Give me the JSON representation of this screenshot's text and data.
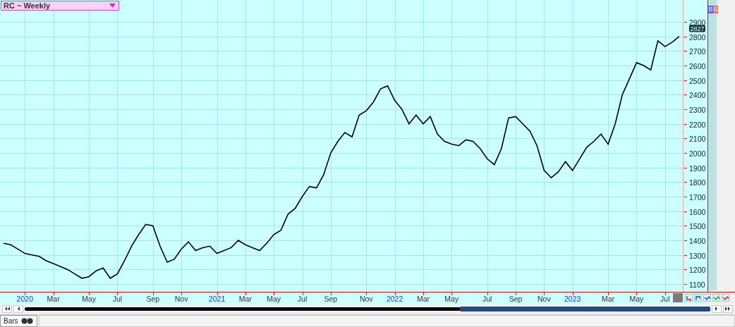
{
  "title_dropdown": {
    "label": "RC ~ Weekly"
  },
  "trade_buttons": [
    {
      "label": "B",
      "color": "#5a63f0"
    },
    {
      "label": "S",
      "color": "#f06a6a"
    }
  ],
  "chart": {
    "last_price": "2827",
    "chart_data": {
      "type": "line",
      "grid": true,
      "ylim": [
        1047,
        3050
      ],
      "categories": [
        null,
        null,
        null,
        "2020",
        null,
        null,
        null,
        "Mar",
        null,
        null,
        null,
        null,
        "May",
        null,
        null,
        null,
        "Jul",
        null,
        null,
        null,
        null,
        "Sep",
        null,
        null,
        null,
        "Nov",
        null,
        null,
        null,
        null,
        "2021",
        null,
        null,
        null,
        "Mar",
        null,
        null,
        null,
        "May",
        null,
        null,
        null,
        "Jul",
        null,
        null,
        null,
        "Sep",
        null,
        null,
        null,
        null,
        "Nov",
        null,
        null,
        null,
        "2022",
        null,
        null,
        null,
        "Mar",
        null,
        null,
        null,
        "May",
        null,
        null,
        null,
        null,
        "Jul",
        null,
        null,
        null,
        "Sep",
        null,
        null,
        null,
        "Nov",
        null,
        null,
        null,
        "2023",
        null,
        null,
        null,
        null,
        "Mar",
        null,
        null,
        null,
        "May",
        null,
        null,
        null,
        "Jul",
        null,
        null
      ],
      "yticks": [
        1100,
        1200,
        1300,
        1400,
        1500,
        1600,
        1700,
        1800,
        1900,
        2000,
        2100,
        2200,
        2300,
        2400,
        2500,
        2600,
        2700,
        2800,
        2900
      ],
      "values": [
        1380,
        1370,
        1340,
        1310,
        1300,
        1290,
        1260,
        1240,
        1220,
        1200,
        1170,
        1140,
        1150,
        1190,
        1210,
        1140,
        1170,
        1260,
        1360,
        1440,
        1510,
        1500,
        1360,
        1250,
        1270,
        1340,
        1390,
        1330,
        1350,
        1360,
        1310,
        1330,
        1350,
        1400,
        1370,
        1350,
        1330,
        1380,
        1440,
        1470,
        1580,
        1620,
        1700,
        1770,
        1760,
        1850,
        2000,
        2080,
        2140,
        2110,
        2260,
        2290,
        2350,
        2440,
        2460,
        2360,
        2300,
        2200,
        2260,
        2200,
        2250,
        2130,
        2080,
        2060,
        2050,
        2090,
        2080,
        2030,
        1960,
        1920,
        2030,
        2240,
        2250,
        2200,
        2150,
        2050,
        1880,
        1830,
        1870,
        1940,
        1880,
        1960,
        2040,
        2080,
        2130,
        2060,
        2200,
        2400,
        2510,
        2620,
        2600,
        2570,
        2770,
        2730,
        2760,
        2800
      ]
    }
  },
  "tabs": [
    {
      "label": "Bars",
      "selected": true
    }
  ]
}
